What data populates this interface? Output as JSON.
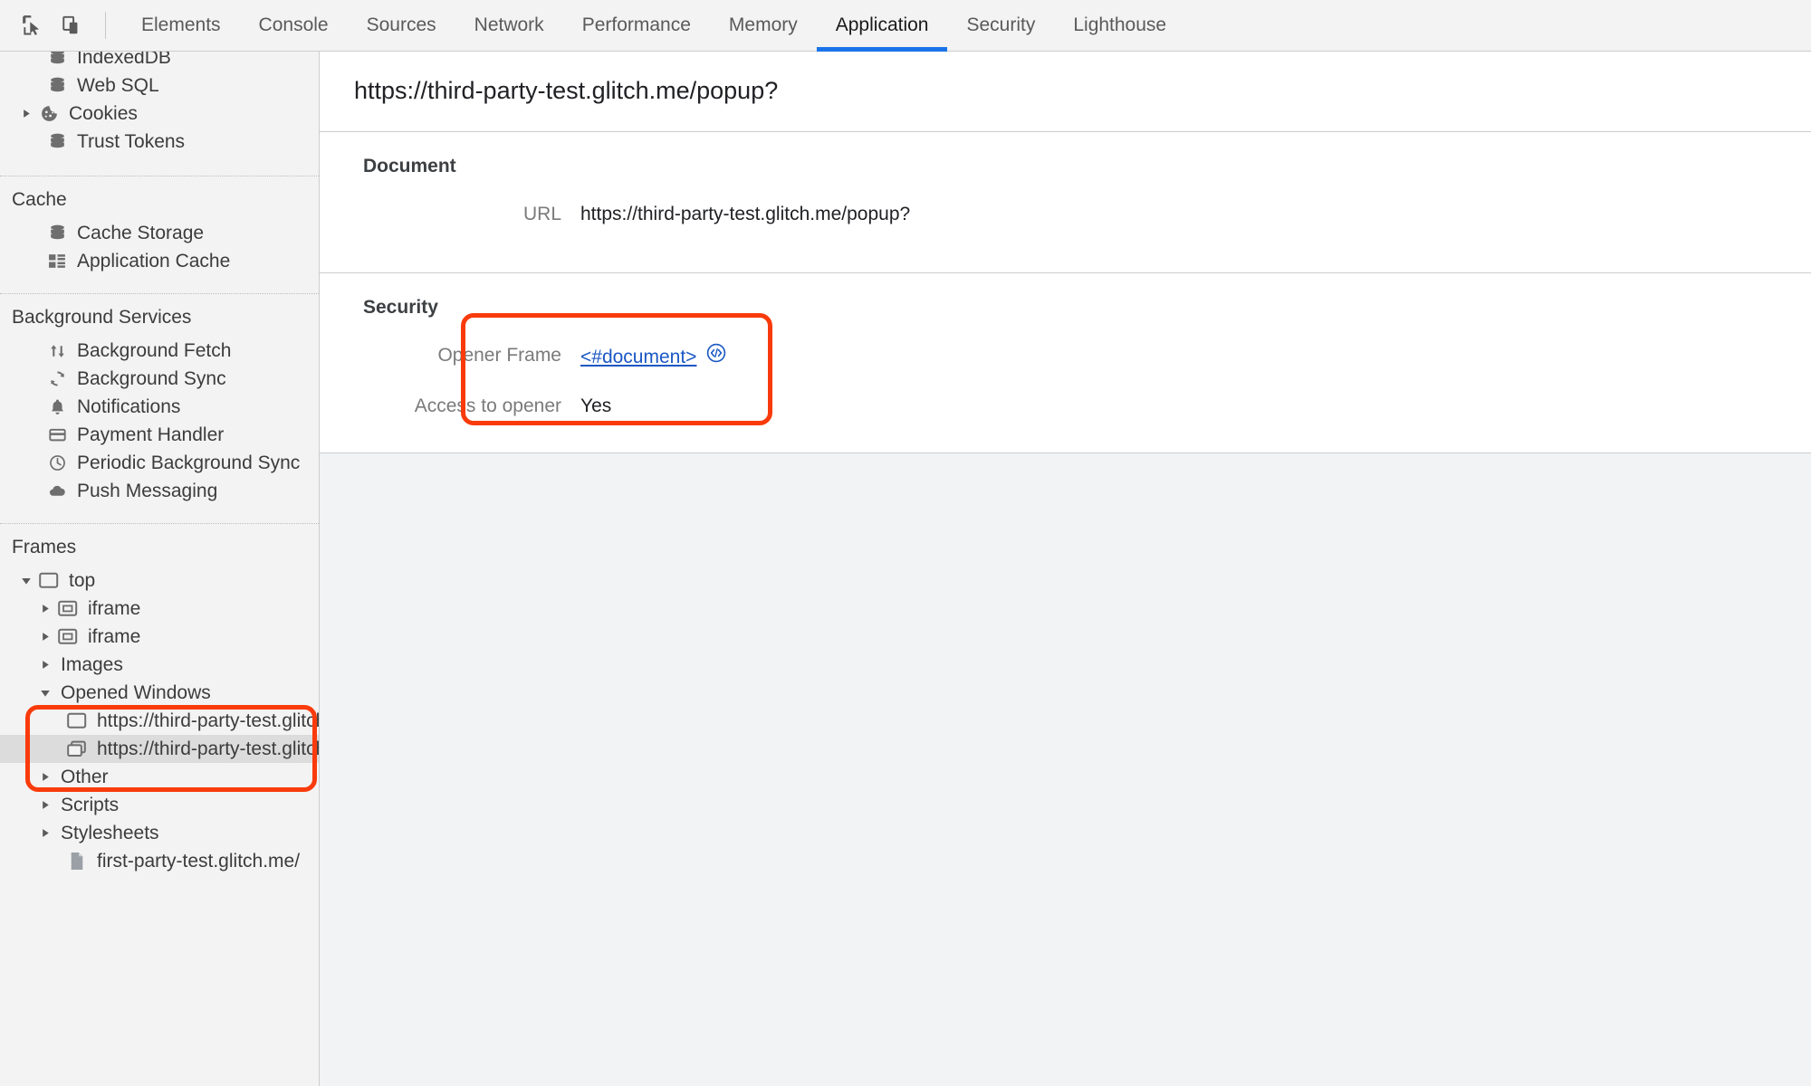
{
  "toolbar": {
    "inspect_icon": "inspect-cursor-icon",
    "device_toolbar_icon": "device-toolbar-icon",
    "tabs": [
      {
        "label": "Elements",
        "active": false
      },
      {
        "label": "Console",
        "active": false
      },
      {
        "label": "Sources",
        "active": false
      },
      {
        "label": "Network",
        "active": false
      },
      {
        "label": "Performance",
        "active": false
      },
      {
        "label": "Memory",
        "active": false
      },
      {
        "label": "Application",
        "active": true
      },
      {
        "label": "Security",
        "active": false
      },
      {
        "label": "Lighthouse",
        "active": false
      }
    ],
    "active_tab": "Application",
    "accent_color": "#1a73e8"
  },
  "sidebar": {
    "storage_items": [
      {
        "label": "IndexedDB",
        "icon": "database-icon",
        "expandable": true
      },
      {
        "label": "Web SQL",
        "icon": "database-icon",
        "expandable": false
      },
      {
        "label": "Cookies",
        "icon": "cookie-icon",
        "expandable": true
      },
      {
        "label": "Trust Tokens",
        "icon": "database-icon",
        "expandable": false
      }
    ],
    "cache": {
      "title": "Cache",
      "items": [
        {
          "label": "Cache Storage",
          "icon": "database-icon"
        },
        {
          "label": "Application Cache",
          "icon": "grid-icon"
        }
      ]
    },
    "background_services": {
      "title": "Background Services",
      "items": [
        {
          "label": "Background Fetch",
          "icon": "updown-arrows-icon"
        },
        {
          "label": "Background Sync",
          "icon": "sync-icon"
        },
        {
          "label": "Notifications",
          "icon": "bell-icon"
        },
        {
          "label": "Payment Handler",
          "icon": "credit-card-icon"
        },
        {
          "label": "Periodic Background Sync",
          "icon": "clock-icon"
        },
        {
          "label": "Push Messaging",
          "icon": "cloud-icon"
        }
      ]
    },
    "frames": {
      "title": "Frames",
      "tree": [
        {
          "label": "top",
          "icon": "frame-icon",
          "expanded": true,
          "depth": 1
        },
        {
          "label": "iframe",
          "icon": "iframe-icon",
          "expanded": false,
          "depth": 2
        },
        {
          "label": "iframe",
          "icon": "iframe-icon",
          "expanded": false,
          "depth": 2
        },
        {
          "label": "Images",
          "icon": "none",
          "expanded": false,
          "depth": 2
        },
        {
          "label": "Opened Windows",
          "icon": "none",
          "expanded": true,
          "depth": 2
        },
        {
          "label": "https://third-party-test.glitch.",
          "icon": "frame-icon",
          "expanded": false,
          "depth": 3,
          "selected": false
        },
        {
          "label": "https://third-party-test.glitch.",
          "icon": "windows-icon",
          "expanded": false,
          "depth": 3,
          "selected": true
        },
        {
          "label": "Other",
          "icon": "none",
          "expanded": false,
          "depth": 2
        },
        {
          "label": "Scripts",
          "icon": "none",
          "expanded": false,
          "depth": 2
        },
        {
          "label": "Stylesheets",
          "icon": "none",
          "expanded": false,
          "depth": 2
        },
        {
          "label": "first-party-test.glitch.me/",
          "icon": "document-icon",
          "expanded": false,
          "depth": 3
        }
      ]
    },
    "highlight_color": "#f93b0b"
  },
  "main": {
    "title": "https://third-party-test.glitch.me/popup?",
    "document_panel": {
      "title": "Document",
      "rows": [
        {
          "key": "URL",
          "value": "https://third-party-test.glitch.me/popup?"
        }
      ]
    },
    "security_panel": {
      "title": "Security",
      "rows": [
        {
          "key": "Opener Frame",
          "value": "<#document>",
          "is_link": true,
          "icon": "code-icon"
        },
        {
          "key": "Access to opener",
          "value": "Yes",
          "is_link": false
        }
      ]
    },
    "highlight_color": "#f93b0b"
  }
}
